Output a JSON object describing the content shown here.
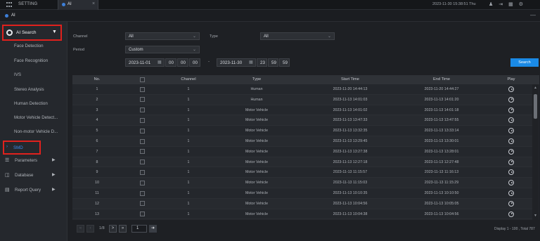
{
  "topbar": {
    "app_title": "SETTING",
    "tab_label": "AI",
    "tab_close": "×",
    "datetime": "2023-11-30 15:38:51 Thu",
    "icons": [
      "user-icon",
      "logout-icon",
      "grid-icon",
      "settings-icon"
    ]
  },
  "breadcrumb": {
    "label": "AI",
    "minimize": "—"
  },
  "sidebar": {
    "search_label": "AI Search",
    "items": [
      "Face Detection",
      "Face Recognition",
      "IVS",
      "Stereo Analysis",
      "Human Detection",
      "Motor Vehicle Detect...",
      "Non-motor Vehicle D..."
    ],
    "selected": "SMD",
    "groups": [
      {
        "label": "Parameters",
        "icon": "list-icon"
      },
      {
        "label": "Database",
        "icon": "database-icon"
      },
      {
        "label": "Report Query",
        "icon": "chart-icon"
      }
    ],
    "accent_color": "#3b8cf0",
    "highlight_color": "#e0211d"
  },
  "filters": {
    "channel_label": "Channel",
    "channel_value": "All",
    "type_label": "Type",
    "type_value": "All",
    "period_label": "Period",
    "period_value": "Custom",
    "start_date": "2023-11-01",
    "start_hh": "00",
    "start_mm": "00",
    "start_ss": "00",
    "end_date": "2023-11-30",
    "end_hh": "23",
    "end_mm": "59",
    "end_ss": "59",
    "separator": "-",
    "search_button": "Search"
  },
  "table": {
    "headers": {
      "no": "No.",
      "channel": "Channel",
      "type": "Type",
      "start": "Start Time",
      "end": "End Time",
      "play": "Play"
    },
    "rows": [
      {
        "no": "1",
        "channel": "1",
        "type": "Human",
        "start": "2023-11-20 14:44:13",
        "end": "2023-11-20 14:44:27"
      },
      {
        "no": "2",
        "channel": "1",
        "type": "Human",
        "start": "2023-11-13 14:01:03",
        "end": "2023-11-13 14:01:20"
      },
      {
        "no": "3",
        "channel": "1",
        "type": "Motor Vehicle",
        "start": "2023-11-13 14:01:02",
        "end": "2023-11-13 14:01:18"
      },
      {
        "no": "4",
        "channel": "1",
        "type": "Motor Vehicle",
        "start": "2023-11-13 13:47:33",
        "end": "2023-11-13 13:47:55"
      },
      {
        "no": "5",
        "channel": "1",
        "type": "Motor Vehicle",
        "start": "2023-11-13 13:32:35",
        "end": "2023-11-13 13:33:14"
      },
      {
        "no": "6",
        "channel": "1",
        "type": "Motor Vehicle",
        "start": "2023-11-13 13:29:45",
        "end": "2023-11-13 13:30:01"
      },
      {
        "no": "7",
        "channel": "1",
        "type": "Motor Vehicle",
        "start": "2023-11-13 13:27:38",
        "end": "2023-11-13 13:28:01"
      },
      {
        "no": "8",
        "channel": "1",
        "type": "Motor Vehicle",
        "start": "2023-11-13 12:27:18",
        "end": "2023-11-13 12:27:48"
      },
      {
        "no": "9",
        "channel": "1",
        "type": "Motor Vehicle",
        "start": "2023-11-13 11:15:57",
        "end": "2023-11-13 11:16:13"
      },
      {
        "no": "10",
        "channel": "1",
        "type": "Motor Vehicle",
        "start": "2023-11-13 11:15:03",
        "end": "2023-11-13 11:15:29"
      },
      {
        "no": "11",
        "channel": "1",
        "type": "Motor Vehicle",
        "start": "2023-11-13 10:10:35",
        "end": "2023-11-13 10:10:50"
      },
      {
        "no": "12",
        "channel": "1",
        "type": "Motor Vehicle",
        "start": "2023-11-13 10:04:56",
        "end": "2023-11-13 10:05:05"
      },
      {
        "no": "13",
        "channel": "1",
        "type": "Motor Vehicle",
        "start": "2023-11-13 10:04:38",
        "end": "2023-11-13 10:04:56"
      }
    ]
  },
  "pager": {
    "prev_first": "«",
    "prev": "‹",
    "page_info": "1/8",
    "next": ">",
    "last": "»",
    "page_input": "1",
    "go": "➜",
    "total": "Display 1 - 100 , Total 787"
  }
}
